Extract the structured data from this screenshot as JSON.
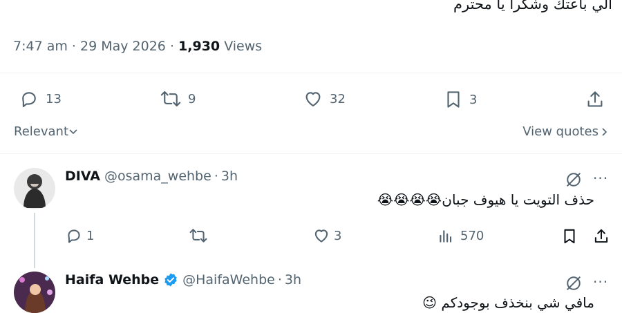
{
  "tweet": {
    "text": "الي باعتك وشكرا يا محترم",
    "time": "7:47 am",
    "date": "29 May 2026",
    "views_count": "1,930",
    "views_label": "Views",
    "replies": "13",
    "reposts": "9",
    "likes": "32",
    "bookmarks": "3"
  },
  "filters": {
    "sort_label": "Relevant",
    "view_quotes_label": "View quotes"
  },
  "replies": [
    {
      "name": "DIVA",
      "handle": "@osama_wehbe",
      "age": "3h",
      "text": "حذف التويت يا هيوف جبان😭😭😭😭",
      "replies": "1",
      "reposts": "",
      "likes": "3",
      "views": "570"
    },
    {
      "name": "Haifa Wehbe",
      "handle": "@HaifaWehbe",
      "age": "3h",
      "text": "مافي شي بنخذف بوجودكم 😉"
    }
  ],
  "colors": {
    "muted": "#536471",
    "text": "#0f1419",
    "verified": "#1d9bf0",
    "divider": "#eff3f4"
  }
}
